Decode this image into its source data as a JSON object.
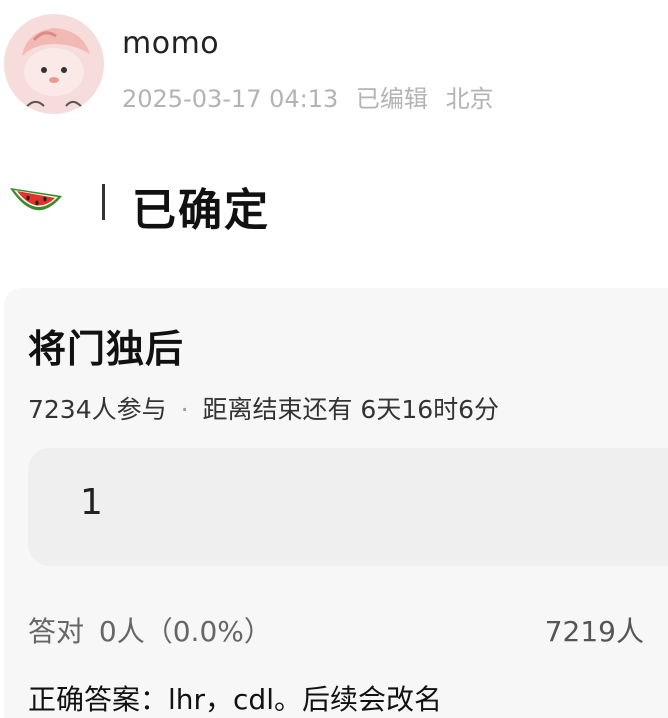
{
  "post": {
    "username": "momo",
    "timestamp": "2025-03-17 04:13",
    "edited_label": "已编辑",
    "location": "北京",
    "status_icon": "watermelon-icon",
    "status_text": "已确定"
  },
  "poll": {
    "title": "将门独后",
    "participants": "7234人参与",
    "separator": "·",
    "time_left": "距离结束还有 6天16时6分",
    "option_text": "1",
    "result_label": "答对",
    "result_count": "0人（0.0%）",
    "other_count": "7219人",
    "answer_text": "正确答案：lhr，cdl。后续会改名"
  },
  "colors": {
    "avatar_bg": "#f6dcda",
    "card_bg": "#f7f7f7",
    "option_bg": "#efefef",
    "meta_text": "#b3b3b3"
  }
}
